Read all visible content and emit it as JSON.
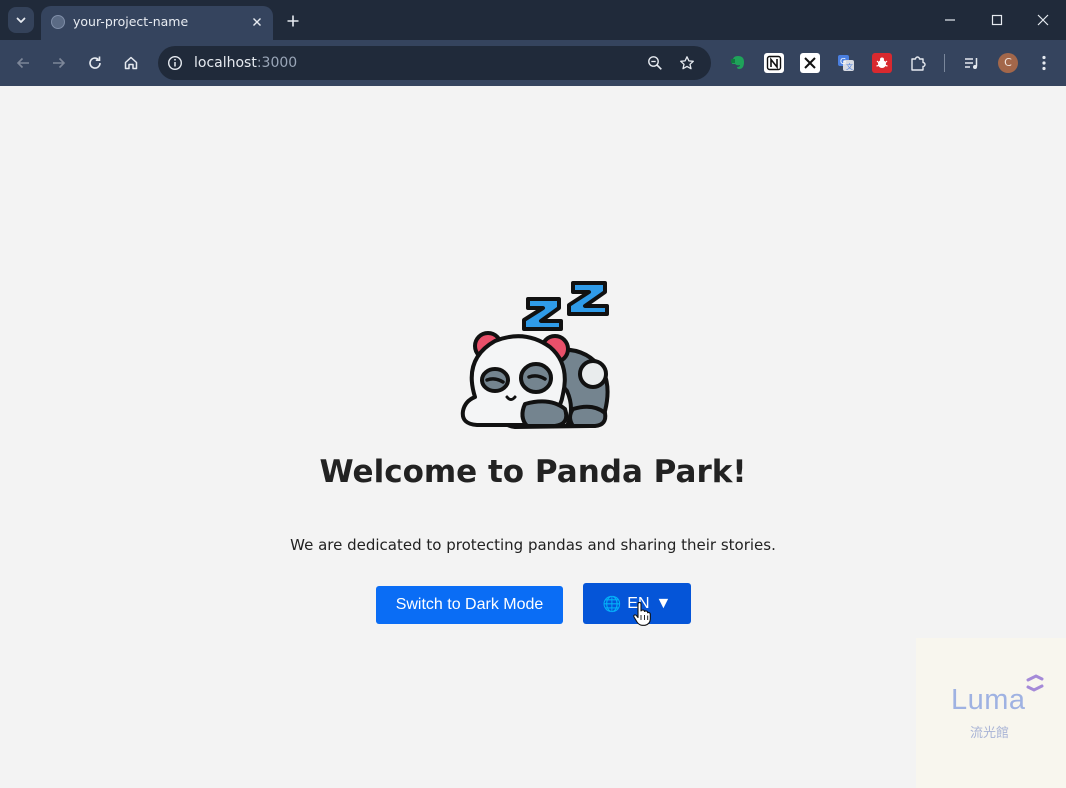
{
  "browser": {
    "tab_title": "your-project-name",
    "url_host": "localhost",
    "url_port": ":3000",
    "profile_initial": "C"
  },
  "page": {
    "heading": "Welcome to Panda Park!",
    "subtitle": "We are dedicated to protecting pandas and sharing their stories.",
    "dark_mode_button": "Switch to Dark Mode",
    "language_button": {
      "globe": "🌐",
      "label": "EN",
      "arrow": "▼"
    },
    "illustration": "sleeping-panda"
  },
  "watermark": {
    "brand": "Luma",
    "subtitle": "流光館"
  },
  "colors": {
    "primary_button": "#0a6df5",
    "language_button": "#0555d8",
    "page_background": "#f3f3f3",
    "browser_frame": "#202a3a",
    "toolbar": "#35445e"
  }
}
